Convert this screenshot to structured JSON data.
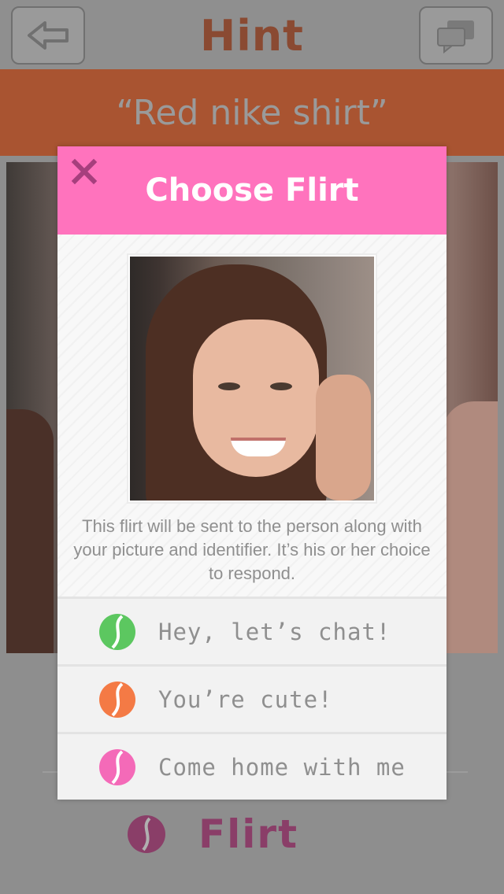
{
  "app": {
    "logo_text": "Hint",
    "back_button": "back-arrow-icon",
    "chat_button": "chat-bubbles-icon"
  },
  "hint_banner": {
    "text": "“Red nike shirt”"
  },
  "flirt_button": {
    "label": "Flirt",
    "icon": "heart-swirl-icon",
    "color": "#8a3e68"
  },
  "modal": {
    "title": "Choose Flirt",
    "close_icon": "close-icon",
    "header_color": "#ff73bd",
    "disclaimer": "This flirt will be sent to the person along with your picture and identifier. It’s his or her choice to respond.",
    "options": [
      {
        "label": "Hey, let’s chat!",
        "icon": "green-heart-icon",
        "color": "#5cc760"
      },
      {
        "label": "You’re cute!",
        "icon": "orange-heart-icon",
        "color": "#f47a45"
      },
      {
        "label": "Come home with me",
        "icon": "pink-heart-icon",
        "color": "#f46ab8"
      }
    ]
  }
}
